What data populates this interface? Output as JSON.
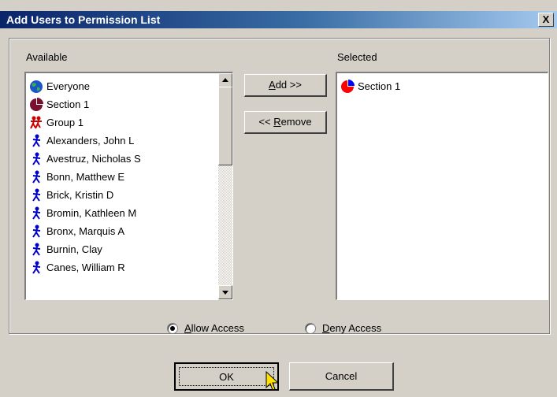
{
  "window": {
    "title": "Add Users to Permission List",
    "close_label": "X"
  },
  "available": {
    "label": "Available",
    "items": [
      {
        "label": "Everyone",
        "icon": "globe-icon"
      },
      {
        "label": "Section 1",
        "icon": "section-pie-icon"
      },
      {
        "label": "Group 1",
        "icon": "group-icon"
      },
      {
        "label": "Alexanders, John L",
        "icon": "user-icon"
      },
      {
        "label": "Avestruz, Nicholas S",
        "icon": "user-icon"
      },
      {
        "label": "Bonn, Matthew E",
        "icon": "user-icon"
      },
      {
        "label": "Brick, Kristin D",
        "icon": "user-icon"
      },
      {
        "label": "Bromin, Kathleen M",
        "icon": "user-icon"
      },
      {
        "label": "Bronx, Marquis A",
        "icon": "user-icon"
      },
      {
        "label": "Burnin, Clay",
        "icon": "user-icon"
      },
      {
        "label": "Canes, William R",
        "icon": "user-icon"
      }
    ]
  },
  "selected": {
    "label": "Selected",
    "items": [
      {
        "label": "Section 1",
        "icon": "section-pie-icon"
      }
    ]
  },
  "buttons": {
    "add": {
      "underline": "A",
      "rest": "dd >>"
    },
    "remove": {
      "pre": "<< ",
      "underline": "R",
      "rest": "emove"
    },
    "ok": "OK",
    "cancel": "Cancel"
  },
  "access": {
    "allow": {
      "underline": "A",
      "rest": "llow Access",
      "checked": true
    },
    "deny": {
      "underline": "D",
      "rest": "eny Access",
      "checked": false
    }
  },
  "colors": {
    "titlebar": "#0a246a",
    "user_icon": "#0000cc",
    "group_icon": "#cc0000",
    "section_icon": "#7a1030",
    "selected_section_icon": "#ff0000"
  }
}
